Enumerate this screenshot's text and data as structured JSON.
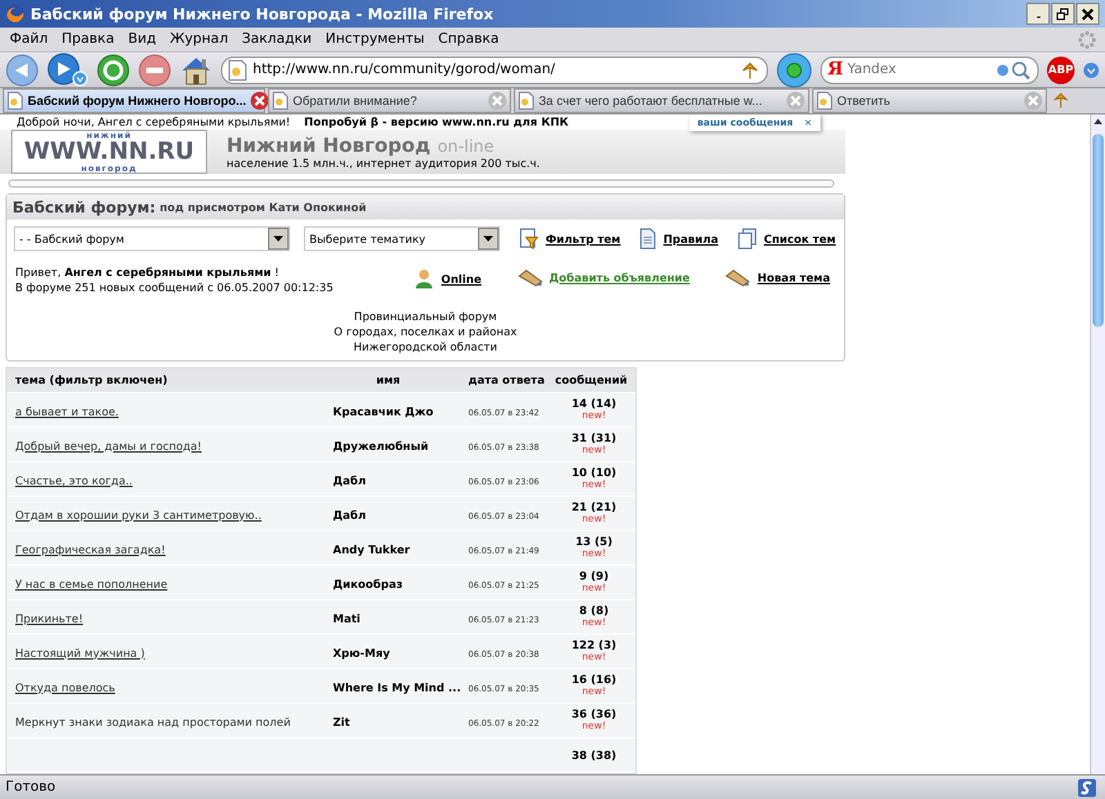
{
  "window": {
    "title": "Бабский форум Нижнего Новгорода - Mozilla Firefox"
  },
  "menu": [
    "Файл",
    "Правка",
    "Вид",
    "Журнал",
    "Закладки",
    "Инструменты",
    "Справка"
  ],
  "toolbar": {
    "url": "http://www.nn.ru/community/gorod/woman/",
    "search_mark": "Я",
    "search_placeholder": "Yandex",
    "adblock": "ABP"
  },
  "tabs": [
    {
      "label": "Бабский форум Нижнего Новгоро...",
      "selected": true
    },
    {
      "label": "Обратили внимание?",
      "selected": false
    },
    {
      "label": "За счет чего работают бесплатные w...",
      "selected": false
    },
    {
      "label": "Ответить",
      "selected": false
    }
  ],
  "header": {
    "greeting": "Доброй ночи, Ангел с серебряными крыльями!",
    "promo": "Попробуй β - версию www.nn.ru для КПК",
    "logo_top": "нижний",
    "logo_main": "WWW.NN.RU",
    "logo_bottom": "новгород",
    "site_title": "Нижний Новгород",
    "site_suffix": "on-line",
    "stats": "население 1.5 млн.ч., интернет аудитория 200 тыс.ч.",
    "notice": "ваши сообщения",
    "notice_close": "×"
  },
  "forum": {
    "title": "Бабский форум:",
    "subtitle": "под присмотром Кати Опокиной",
    "selects": [
      "- - Бабский форум",
      "Выберите тематику"
    ],
    "links": [
      {
        "label": "Фильтр тем",
        "kind": "filter",
        "color": "#000000"
      },
      {
        "label": "Правила",
        "kind": "page",
        "color": "#000000"
      },
      {
        "label": "Список тем",
        "kind": "pages",
        "color": "#000000"
      },
      {
        "label": "Online",
        "kind": "user",
        "color": "#000000"
      },
      {
        "label": "Добавить объявление",
        "kind": "pencil",
        "color": "#3a8a2a"
      },
      {
        "label": "Новая тема",
        "kind": "pencil",
        "color": "#000000"
      }
    ],
    "hello": "Привет, **Ангел с серебряными крыльями** !",
    "new_info": "В форуме 251 новых сообщений с 06.05.2007 00:12:35",
    "description": [
      "Провинциальный форум",
      "О городах, поселках и районах",
      "Нижегородской области"
    ]
  },
  "table": {
    "columns": [
      "тема (фильтр включен)",
      "имя",
      "дата ответа",
      "сообщений"
    ],
    "rows": [
      {
        "title": "а бывает и такое.",
        "linked": true,
        "author": "Красавчик Джо",
        "date": "06.05.07 в 23:42",
        "count": "14 (14)",
        "new": "new!"
      },
      {
        "title": "Добрый вечер, дамы и господа!",
        "linked": true,
        "author": "Дружелюбный",
        "date": "06.05.07 в 23:38",
        "count": "31 (31)",
        "new": "new!"
      },
      {
        "title": "Счастье, это когда..",
        "linked": true,
        "author": "Дабл",
        "date": "06.05.07 в 23:06",
        "count": "10 (10)",
        "new": "new!"
      },
      {
        "title": "Отдам в хорошии руки 3 сантиметровую..",
        "linked": true,
        "author": "Дабл",
        "date": "06.05.07 в 23:04",
        "count": "21 (21)",
        "new": "new!"
      },
      {
        "title": "Географическая загадка!",
        "linked": true,
        "author": "Andy Tukker",
        "date": "06.05.07 в 21:49",
        "count": "13 (5)",
        "new": "new!"
      },
      {
        "title": "У нас в семье пополнение",
        "linked": true,
        "author": "Дикообраз",
        "date": "06.05.07 в 21:25",
        "count": "9 (9)",
        "new": "new!"
      },
      {
        "title": "Прикиньте!",
        "linked": true,
        "author": "Mati",
        "date": "06.05.07 в 21:23",
        "count": "8 (8)",
        "new": "new!"
      },
      {
        "title": "Настоящий мужчина )",
        "linked": true,
        "author": "Хрю-Мяу",
        "date": "06.05.07 в 20:38",
        "count": "122 (3)",
        "new": "new!"
      },
      {
        "title": "Откуда повелось",
        "linked": true,
        "author": "Where Is My Mind ...",
        "date": "06.05.07 в 20:35",
        "count": "16 (16)",
        "new": "new!"
      },
      {
        "title": "Меркнут знаки зодиака над просторами полей",
        "linked": false,
        "author": "Zit",
        "date": "06.05.07 в 20:22",
        "count": "36 (36)",
        "new": "new!"
      },
      {
        "count": "38 (38)"
      }
    ]
  },
  "status_bar": "Готово"
}
